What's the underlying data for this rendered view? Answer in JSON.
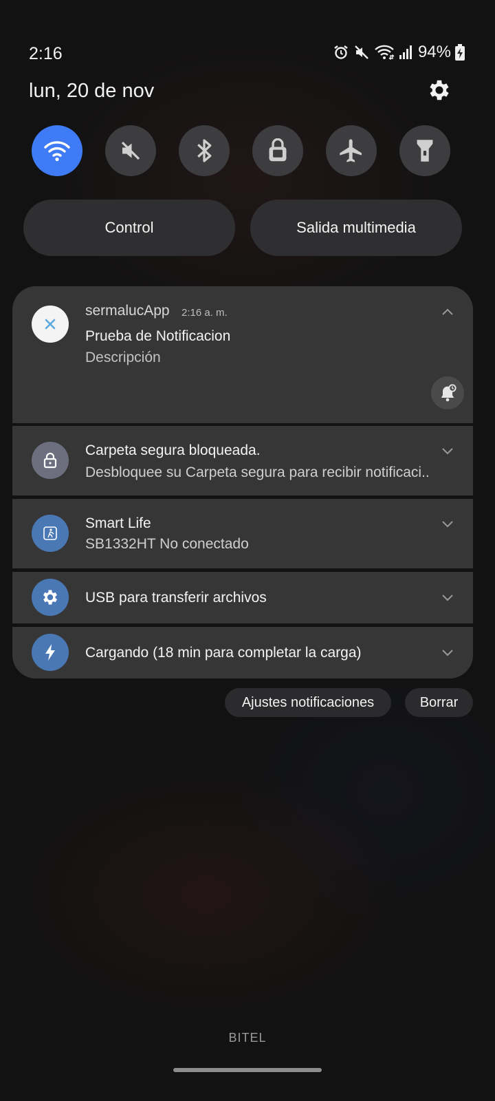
{
  "status_bar": {
    "time": "2:16",
    "battery_percent": "94%",
    "icons": [
      "alarm-icon",
      "mute-icon",
      "wifi-icon",
      "signal-icon",
      "battery-charging-icon"
    ]
  },
  "header": {
    "date": "lun, 20 de nov",
    "settings_icon": "gear-icon"
  },
  "quick_toggles": [
    {
      "icon": "wifi-icon",
      "active": true
    },
    {
      "icon": "mute-icon",
      "active": false
    },
    {
      "icon": "bluetooth-icon",
      "active": false
    },
    {
      "icon": "secure-folder-icon",
      "active": false
    },
    {
      "icon": "airplane-icon",
      "active": false
    },
    {
      "icon": "flashlight-icon",
      "active": false
    }
  ],
  "pills": {
    "control": "Control",
    "media_output": "Salida multimedia"
  },
  "notifications": [
    {
      "app": "sermalucApp",
      "time": "2:16 a. m.",
      "title": "Prueba de Notificacion",
      "text": "Descripción",
      "icon": "cross-app-icon",
      "expanded": true
    },
    {
      "title": "Carpeta segura bloqueada.",
      "text": "Desbloquee su Carpeta segura para recibir notificaci..",
      "icon": "lock-icon"
    },
    {
      "title": "Smart Life",
      "text": "SB1332HT No conectado",
      "icon": "smart-life-icon"
    },
    {
      "title": "USB para transferir archivos",
      "icon": "usb-settings-icon"
    },
    {
      "title": "Cargando (18 min para completar la carga)",
      "icon": "charging-bolt-icon"
    }
  ],
  "actions": {
    "notification_settings": "Ajustes notificaciones",
    "clear": "Borrar"
  },
  "carrier": "BITEL",
  "colors": {
    "accent_blue": "#3e7bf5",
    "card_bg": "#363637",
    "toggle_bg": "#3d3d3f"
  }
}
